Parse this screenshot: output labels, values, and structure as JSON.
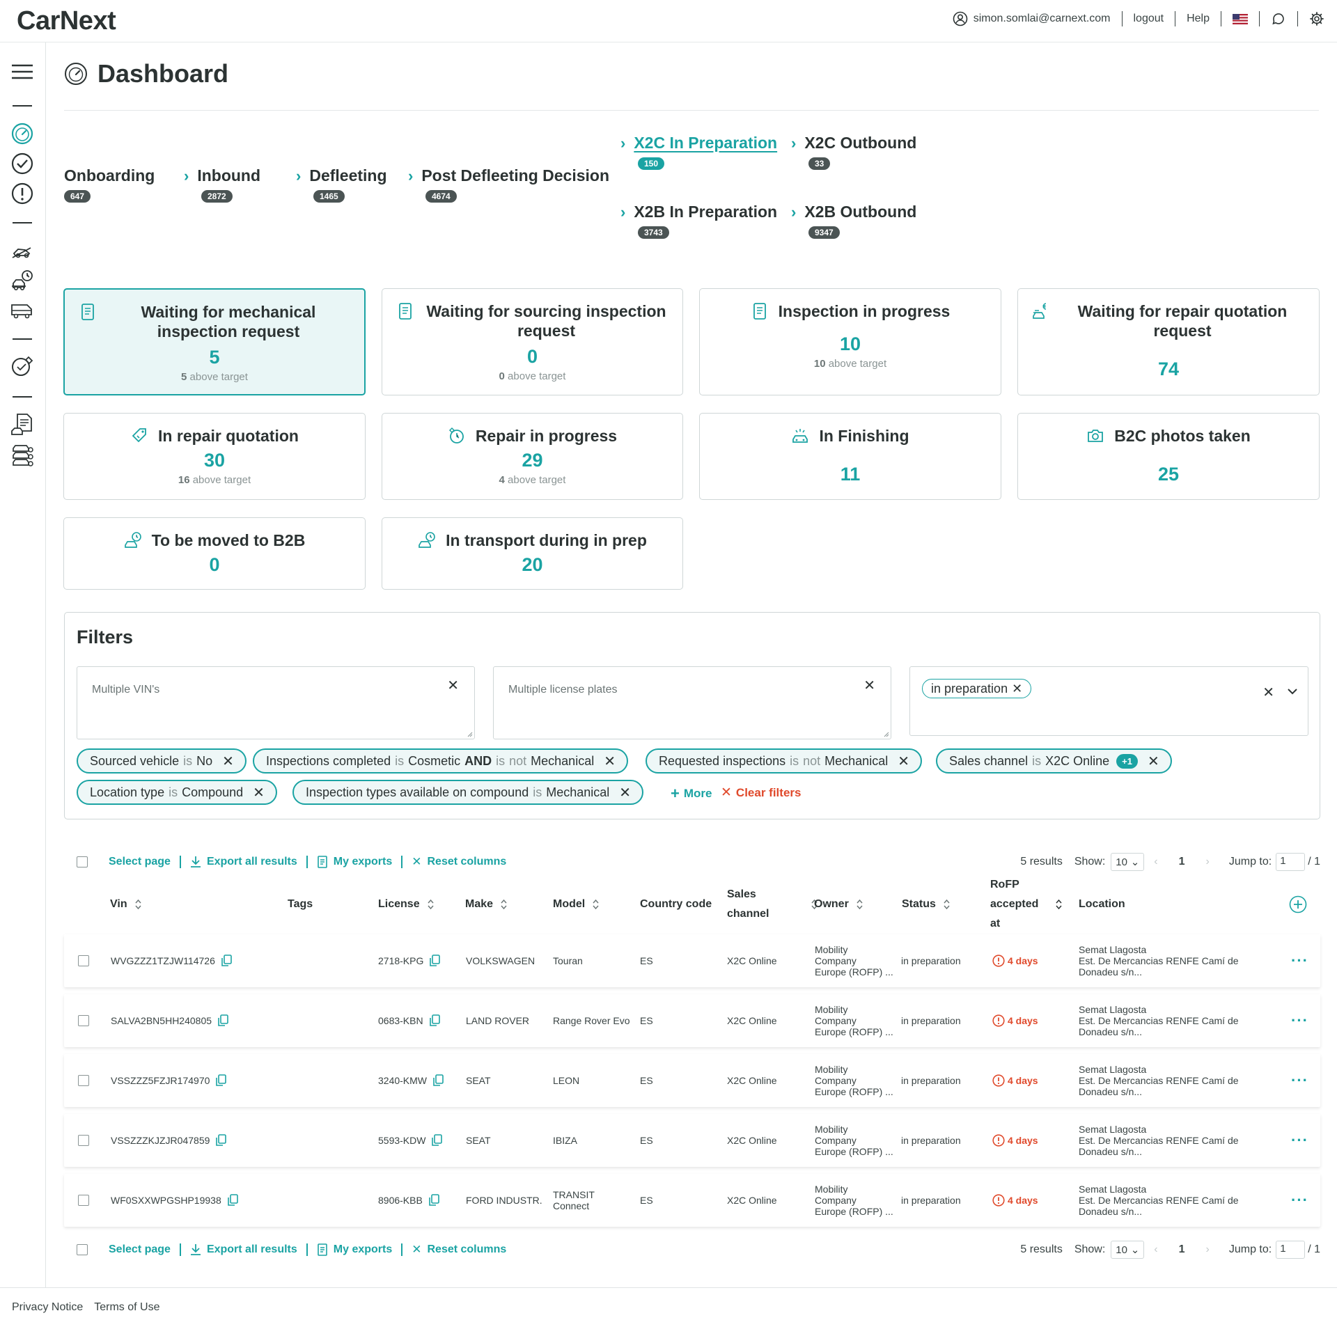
{
  "app": {
    "logo": "CarNext"
  },
  "header": {
    "user_email": "simon.somlai@carnext.com",
    "logout": "logout",
    "help": "Help"
  },
  "page": {
    "title": "Dashboard"
  },
  "pipeline": {
    "onboarding": {
      "label": "Onboarding",
      "count": "647"
    },
    "inbound": {
      "label": "Inbound",
      "count": "2872"
    },
    "defleeting": {
      "label": "Defleeting",
      "count": "1465"
    },
    "post_defleeting": {
      "label": "Post Defleeting Decision",
      "count": "4674"
    },
    "x2c_prep": {
      "label": "X2C In Preparation",
      "count": "150"
    },
    "x2c_out": {
      "label": "X2C Outbound",
      "count": "33"
    },
    "x2b_prep": {
      "label": "X2B In Preparation",
      "count": "3743"
    },
    "x2b_out": {
      "label": "X2B Outbound",
      "count": "9347"
    }
  },
  "cards": [
    {
      "title": "Waiting for mechanical inspection request",
      "value": "5",
      "sub_num": "5",
      "sub_text": "above target"
    },
    {
      "title": "Waiting for sourcing inspection request",
      "value": "0",
      "sub_num": "0",
      "sub_text": "above target"
    },
    {
      "title": "Inspection in progress",
      "value": "10",
      "sub_num": "10",
      "sub_text": "above target"
    },
    {
      "title": "Waiting for repair quotation request",
      "value": "74"
    },
    {
      "title": "In repair quotation",
      "value": "30",
      "sub_num": "16",
      "sub_text": "above target"
    },
    {
      "title": "Repair in progress",
      "value": "29",
      "sub_num": "4",
      "sub_text": "above target"
    },
    {
      "title": "In Finishing",
      "value": "11"
    },
    {
      "title": "B2C photos taken",
      "value": "25"
    },
    {
      "title": "To be moved to B2B",
      "value": "0"
    },
    {
      "title": "In transport during in prep",
      "value": "20"
    }
  ],
  "filters": {
    "title": "Filters",
    "vin_placeholder": "Multiple VIN's",
    "plates_placeholder": "Multiple license plates",
    "status_chip": "in preparation",
    "is_word": "is",
    "not_word": "not",
    "and_word": "AND",
    "chips": {
      "sourced_key": "Sourced vehicle",
      "sourced_val": "No",
      "inspections_key": "Inspections completed",
      "inspections_val1": "Cosmetic",
      "inspections_val2": "Mechanical",
      "requested_key": "Requested inspections",
      "requested_val": "Mechanical",
      "channel_key": "Sales channel",
      "channel_val": "X2C Online",
      "channel_extra": "+1",
      "location_key": "Location type",
      "location_val": "Compound",
      "insp_types_key": "Inspection types available on compound",
      "insp_types_val": "Mechanical"
    },
    "more": "More",
    "clear": "Clear filters"
  },
  "toolbar": {
    "select_page": "Select page",
    "export_all": "Export all results",
    "my_exports": "My exports",
    "reset_columns": "Reset columns",
    "results": "5 results",
    "show_label": "Show:",
    "show_value": "10",
    "page": "1",
    "jump_label": "Jump to:",
    "jump_value": "1",
    "total_pages": "/ 1"
  },
  "table": {
    "columns": {
      "vin": "Vin",
      "tags": "Tags",
      "license": "License",
      "make": "Make",
      "model": "Model",
      "country": "Country code",
      "sales_1": "Sales",
      "sales_2": "channel",
      "owner": "Owner",
      "status": "Status",
      "rofp_1": "RoFP",
      "rofp_2": "accepted",
      "rofp_3": "at",
      "location": "Location"
    },
    "rows": [
      {
        "vin": "WVGZZZ1TZJW114726",
        "license": "2718-KPG",
        "make": "VOLKSWAGEN",
        "model_1": "Touran",
        "model_2": "",
        "country": "ES",
        "channel": "X2C Online",
        "owner_1": "Mobility",
        "owner_2": "Company",
        "owner_3": "Europe (ROFP) ...",
        "status": "in preparation",
        "rofp": "4 days",
        "loc_1": "Semat Llagosta",
        "loc_2": "Est. De Mercancias RENFE Camí de",
        "loc_3": "Donadeu s/n..."
      },
      {
        "vin": "SALVA2BN5HH240805",
        "license": "0683-KBN",
        "make": "LAND ROVER",
        "model_1": "Range Rover Evo",
        "model_2": "",
        "country": "ES",
        "channel": "X2C Online",
        "owner_1": "Mobility",
        "owner_2": "Company",
        "owner_3": "Europe (ROFP) ...",
        "status": "in preparation",
        "rofp": "4 days",
        "loc_1": "Semat Llagosta",
        "loc_2": "Est. De Mercancias RENFE Camí de",
        "loc_3": "Donadeu s/n..."
      },
      {
        "vin": "VSSZZZ5FZJR174970",
        "license": "3240-KMW",
        "make": "SEAT",
        "model_1": "LEON",
        "model_2": "",
        "country": "ES",
        "channel": "X2C Online",
        "owner_1": "Mobility",
        "owner_2": "Company",
        "owner_3": "Europe (ROFP) ...",
        "status": "in preparation",
        "rofp": "4 days",
        "loc_1": "Semat Llagosta",
        "loc_2": "Est. De Mercancias RENFE Camí de",
        "loc_3": "Donadeu s/n..."
      },
      {
        "vin": "VSSZZZKJZJR047859",
        "license": "5593-KDW",
        "make": "SEAT",
        "model_1": "IBIZA",
        "model_2": "",
        "country": "ES",
        "channel": "X2C Online",
        "owner_1": "Mobility",
        "owner_2": "Company",
        "owner_3": "Europe (ROFP) ...",
        "status": "in preparation",
        "rofp": "4 days",
        "loc_1": "Semat Llagosta",
        "loc_2": "Est. De Mercancias RENFE Camí de",
        "loc_3": "Donadeu s/n..."
      },
      {
        "vin": "WF0SXXWPGSHP19938",
        "license": "8906-KBB",
        "make": "FORD INDUSTR.",
        "model_1": "TRANSIT",
        "model_2": "Connect",
        "country": "ES",
        "channel": "X2C Online",
        "owner_1": "Mobility",
        "owner_2": "Company",
        "owner_3": "Europe (ROFP) ...",
        "status": "in preparation",
        "rofp": "4 days",
        "loc_1": "Semat Llagosta",
        "loc_2": "Est. De Mercancias RENFE Camí de",
        "loc_3": "Donadeu s/n..."
      }
    ]
  },
  "footer": {
    "privacy": "Privacy Notice",
    "terms": "Terms of Use"
  },
  "colors": {
    "accent": "#1aa3a3",
    "warning": "#e04a2c",
    "badge": "#4b5454"
  }
}
